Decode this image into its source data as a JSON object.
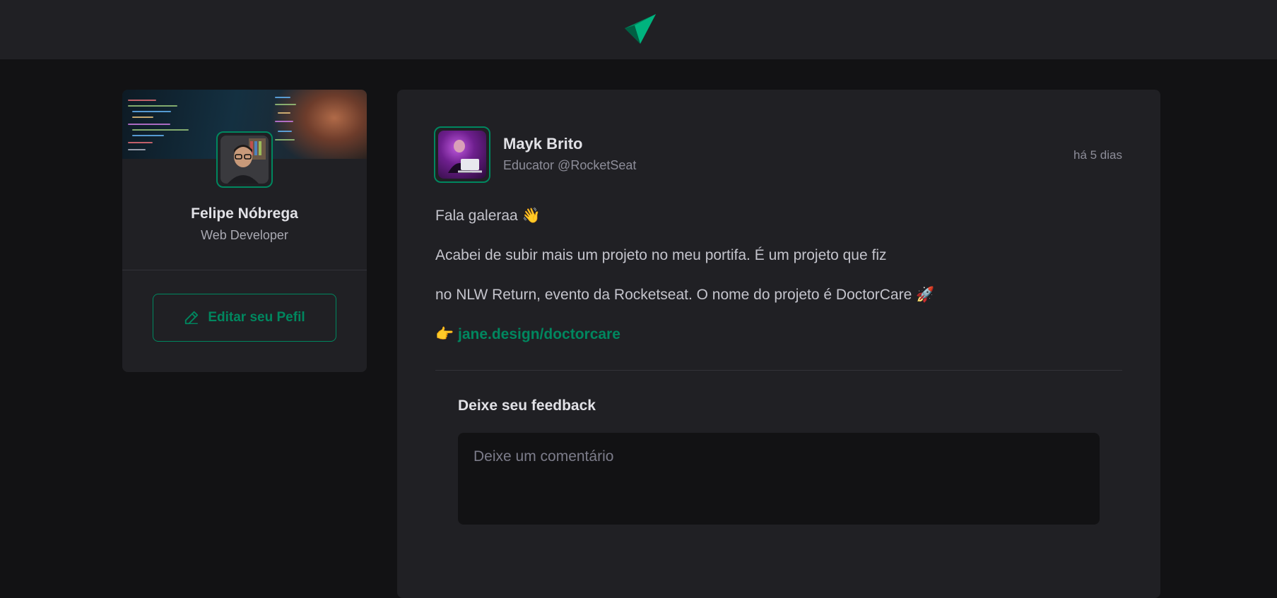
{
  "header": {
    "logo": "paper-plane-logo-icon"
  },
  "profile": {
    "name": "Felipe Nóbrega",
    "role": "Web Developer",
    "edit_button_label": "Editar seu Pefil",
    "edit_icon": "pencil-icon"
  },
  "post": {
    "author_name": "Mayk Brito",
    "author_role": "Educator @RocketSeat",
    "published": "há 5 dias",
    "lines": [
      "Fala galeraa 👋",
      "Acabei de subir mais um projeto no meu portifa. É um projeto que fiz",
      "no NLW Return, evento da Rocketseat. O nome do projeto é DoctorCare 🚀"
    ],
    "link_prefix": "👉",
    "link_text": "jane.design/doctorcare"
  },
  "feedback": {
    "title": "Deixe seu feedback",
    "placeholder": "Deixe um comentário"
  },
  "colors": {
    "accent": "#00875f",
    "background": "#121214",
    "surface": "#202024"
  }
}
